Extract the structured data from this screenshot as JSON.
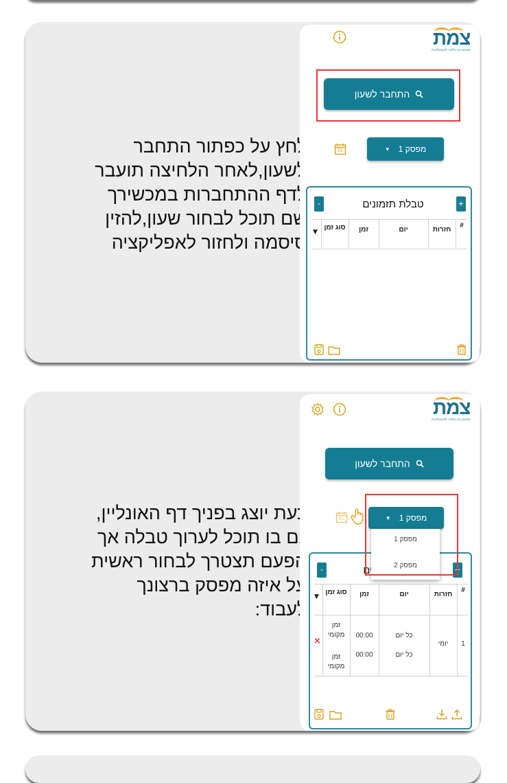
{
  "steps": [
    {
      "instruction_lines": [
        "לחץ על כפתור התחבר",
        "לשעון,לאחר הלחיצה תועבר",
        "לדף ההתחברות במכשירך",
        "שם תוכל לבחור שעון,להזין",
        "סיסמה ולחזור לאפליקציה"
      ],
      "app": {
        "logo_text": "צמת",
        "logo_subtitle": "מסגש בין וולכה לטכנולוגיה",
        "connect_label": "התחבר לשעון",
        "switch_selected": "מפסק 1",
        "calendar_day": "31",
        "table_title": "טבלת תזמונים",
        "plus_label": "+",
        "minus_label": "-",
        "headers": [
          "#",
          "חזרות",
          "יום",
          "זמן",
          "סוג זמן"
        ]
      }
    },
    {
      "instruction_lines": [
        "כעת יוצג בפניך דף האונליין,",
        "גם בו תוכל לערוך טבלה אך",
        "הפעם תצטרך לבחור ראשית",
        "על איזה מפסק ברצונך",
        "לעבוד:"
      ],
      "app": {
        "logo_text": "צמת",
        "logo_subtitle": "מסגש בין וולכה לטכנולוגיה",
        "connect_label": "התחבר לשעון",
        "switch_selected": "מפסק 1",
        "switch_options": [
          "מפסק 1",
          "מפסק 2"
        ],
        "calendar_day": "31",
        "table_title_visible": "ונים",
        "plus_label": "+",
        "minus_label": "-",
        "headers": [
          "#",
          "חזרות",
          "יום",
          "זמן",
          "סוג זמן"
        ],
        "row": {
          "index": "1",
          "repeat": "יומי",
          "entries": [
            {
              "day": "כל יום",
              "time": "00:00",
              "type": "זמן מקומי"
            },
            {
              "day": "כל יום",
              "time": "00:00",
              "type": "זמן מקומי"
            }
          ],
          "delete_icon": "×"
        }
      }
    }
  ],
  "colors": {
    "accent": "#157d93",
    "gold": "#d9a21c",
    "highlight": "#e53935",
    "card": "#ececec"
  }
}
